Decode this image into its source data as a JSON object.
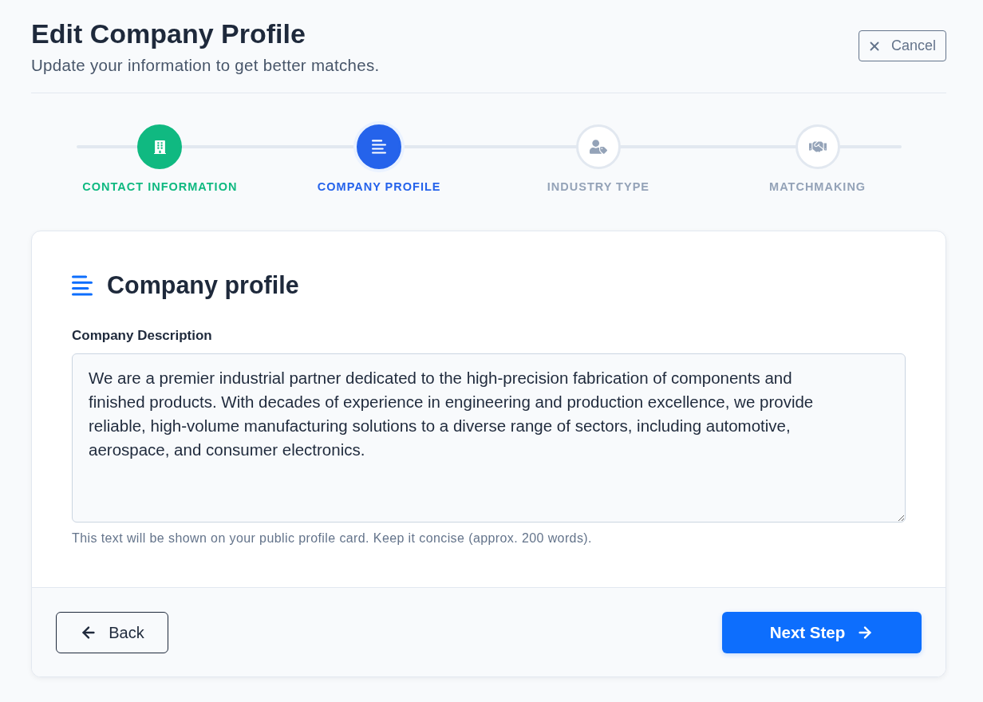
{
  "header": {
    "title": "Edit Company Profile",
    "subtitle": "Update your information to get better matches.",
    "cancel_button": "Cancel"
  },
  "steps": [
    {
      "label": "CONTACT INFORMATION",
      "completed": true,
      "selected": false
    },
    {
      "label": "COMPANY PROFILE",
      "completed": false,
      "selected": true
    },
    {
      "label": "INDUSTRY TYPE",
      "completed": false,
      "selected": false
    },
    {
      "label": "MATCHMAKING",
      "completed": false,
      "selected": false
    }
  ],
  "card": {
    "heading": "Company profile",
    "field": {
      "label": "Company Description",
      "value": "We are a premier industrial partner dedicated to the high-precision fabrication of components and finished products. With decades of experience in engineering and production excellence, we provide reliable, high-volume manufacturing solutions to a diverse range of sectors, including automotive, aerospace, and consumer electronics.",
      "help": "This text will be shown on your public profile card. Keep it concise (approx. 200 words)."
    }
  },
  "footer": {
    "back_button": "Back",
    "next_button": "Next Step"
  }
}
